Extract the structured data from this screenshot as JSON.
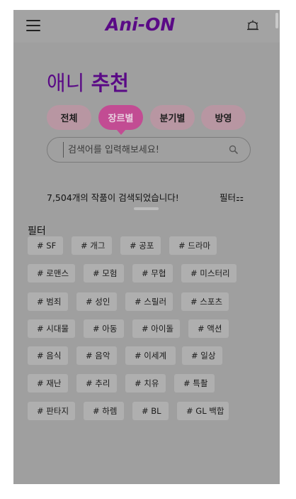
{
  "header": {
    "logo": "Ani-ON",
    "menu_icon": "hamburger-menu-icon",
    "alarm_icon": "alarm-bell-icon"
  },
  "page": {
    "title_part1": "애니",
    "title_part2": "추천"
  },
  "tabs": [
    {
      "label": "전체",
      "active": false
    },
    {
      "label": "장르별",
      "active": true
    },
    {
      "label": "분기별",
      "active": false
    },
    {
      "label": "방영",
      "active": false
    }
  ],
  "search": {
    "placeholder": "검색어를 입력해보세요!",
    "value": ""
  },
  "results": {
    "count_text": "7,504개의 작품이 검색되었습니다!",
    "filter_toggle": "필터⚏"
  },
  "filter": {
    "label": "필터",
    "rows": [
      [
        "# SF",
        "# 개그",
        "# 공포",
        "# 드라마"
      ],
      [
        "# 로맨스",
        "# 모험",
        "# 무협",
        "# 미스터리"
      ],
      [
        "# 범죄",
        "# 성인",
        "# 스릴러",
        "# 스포츠"
      ],
      [
        "# 시대물",
        "# 아동",
        "# 아이돌",
        "# 액션"
      ],
      [
        "# 음식",
        "# 음악",
        "# 이세계",
        "# 일상"
      ],
      [
        "# 재난",
        "# 추리",
        "# 치유",
        "# 특촬"
      ],
      [
        "# 판타지",
        "# 하렘",
        "# BL",
        "# GL 백합"
      ]
    ]
  },
  "colors": {
    "brand": "#5a0a86",
    "active_tab": "#c24c93",
    "overlay": "#9f9f9f"
  }
}
